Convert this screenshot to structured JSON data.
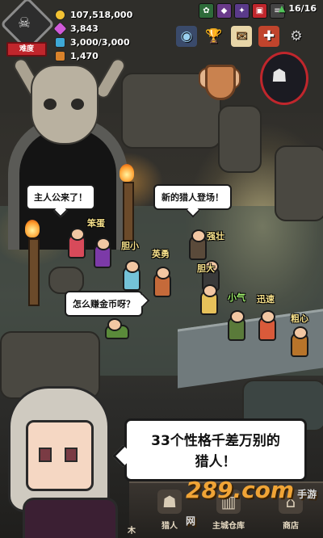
{
  "hud": {
    "rank_label": "难度",
    "gold": "107,518,000",
    "gems": "3,843",
    "capacity": "3,000/3,000",
    "food": "1,470",
    "population": "16/16",
    "colors": {
      "gold": "#f2c233",
      "gem": "#d05ad8",
      "capacity": "#3ea8d6",
      "food": "#d9822b",
      "badge": "#c0262c"
    }
  },
  "speech": {
    "bubble1": "主人公来了！",
    "bubble2": "新的猎人登场！",
    "bubble3": "怎么赚金币呀？",
    "big": [
      "33个性格千差万别的",
      "猎人！"
    ]
  },
  "hunters": [
    "笨蛋",
    "胆小",
    "英勇",
    "强壮",
    "胆大",
    "小气",
    "迅速",
    "粗心"
  ],
  "nav": {
    "partial_left": "木",
    "hunters": "猎人",
    "warehouse": "主城仓库",
    "shop": "商店"
  },
  "watermark": {
    "main": "289.com",
    "sub": "手游网"
  }
}
